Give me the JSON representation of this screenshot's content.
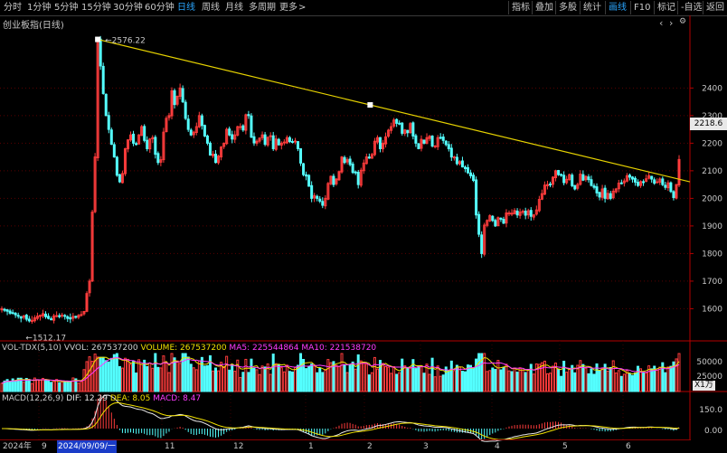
{
  "toolbar": {
    "periods": [
      "分时",
      "1分钟",
      "5分钟",
      "15分钟",
      "30分钟",
      "60分钟",
      "日线",
      "周线",
      "月线",
      "多周期",
      "更多"
    ],
    "active_period": "日线",
    "more_arrow": ">",
    "tools": [
      "指标",
      "叠加",
      "多股",
      "统计",
      "画线",
      "F10",
      "标记",
      "-自选",
      "返回"
    ],
    "active_tool": "画线"
  },
  "chart_title": "创业板指(日线)",
  "price_tag": "2218.6",
  "trendline_labels": {
    "high": "2576.22",
    "low": "1512.17"
  },
  "vol_panel": {
    "name": "VOL-TDX(5,10)",
    "items": [
      {
        "label": "VVOL: 267537200",
        "color": "#d0d0d0"
      },
      {
        "label": "VOLUME: 267537200",
        "color": "#f0e000"
      },
      {
        "label": "MA5: 225544864",
        "color": "#ff3bff"
      },
      {
        "label": "MA10: 221538720",
        "color": "#ff3bff"
      }
    ],
    "ticks": [
      "50000",
      "25000"
    ],
    "unit": "X1万"
  },
  "macd_panel": {
    "name": "MACD(12,26,9)",
    "items": [
      {
        "label": "DIF: 12.29",
        "color": "#e8e8e8"
      },
      {
        "label": "DEA: 8.05",
        "color": "#f0e000"
      },
      {
        "label": "MACD: 8.47",
        "color": "#ff3bff"
      }
    ],
    "ticks": [
      "150.0",
      "0.00"
    ]
  },
  "date_axis": {
    "year": "2024年",
    "month_labels": [
      "9",
      "11",
      "12",
      "1",
      "2",
      "3",
      "4",
      "5",
      "6"
    ],
    "cursor_date": "2024/09/09/一"
  },
  "chart_data": {
    "type": "candlestick",
    "title": "创业板指(日线)",
    "ylim": [
      1490,
      2660
    ],
    "y_ticks": [
      1600,
      1700,
      1800,
      1900,
      2000,
      2100,
      2200,
      2300,
      2400
    ],
    "up_color": "#ff3c3c",
    "down_color": "#54ffff",
    "trendline": {
      "from_value": 2576.22,
      "to_value_at_right_edge": 2060
    },
    "close_path": [
      1600,
      1596,
      1591,
      1584,
      1583,
      1578,
      1573,
      1566,
      1574,
      1562,
      1556,
      1558,
      1567,
      1573,
      1576,
      1582,
      1571,
      1565,
      1561,
      1574,
      1575,
      1573,
      1577,
      1573,
      1565,
      1563,
      1572,
      1570,
      1576,
      1579,
      1590,
      1655,
      1700,
      1950,
      2150,
      2576,
      2480,
      2380,
      2300,
      2250,
      2196,
      2150,
      2084,
      2060,
      2090,
      2180,
      2212,
      2230,
      2200,
      2195,
      2230,
      2260,
      2210,
      2180,
      2215,
      2220,
      2160,
      2130,
      2140,
      2240,
      2290,
      2300,
      2390,
      2340,
      2370,
      2400,
      2350,
      2290,
      2250,
      2230,
      2240,
      2260,
      2300,
      2264,
      2226,
      2200,
      2157,
      2160,
      2130,
      2153,
      2186,
      2200,
      2250,
      2230,
      2215,
      2230,
      2260,
      2260,
      2248,
      2303,
      2300,
      2222,
      2201,
      2207,
      2218,
      2230,
      2196,
      2221,
      2227,
      2180,
      2215,
      2194,
      2200,
      2204,
      2220,
      2206,
      2204,
      2208,
      2180,
      2128,
      2086,
      2081,
      2044,
      2000,
      2010,
      2000,
      1990,
      1975,
      2000,
      2054,
      2080,
      2050,
      2070,
      2097,
      2150,
      2130,
      2140,
      2123,
      2094,
      2095,
      2050,
      2102,
      2128,
      2150,
      2146,
      2159,
      2207,
      2220,
      2180,
      2200,
      2223,
      2247,
      2260,
      2284,
      2272,
      2272,
      2236,
      2248,
      2238,
      2271,
      2226,
      2200,
      2180,
      2214,
      2200,
      2220,
      2225,
      2190,
      2190,
      2220,
      2220,
      2210,
      2195,
      2180,
      2150,
      2150,
      2126,
      2133,
      2114,
      2108,
      2093,
      2082,
      2065,
      1940,
      1870,
      1800,
      1903,
      1920,
      1937,
      1920,
      1900,
      1930,
      1925,
      1910,
      1947,
      1947,
      1946,
      1956,
      1940,
      1950,
      1953,
      1939,
      1955,
      1935,
      1940,
      1958,
      1996,
      2017,
      2048,
      2050,
      2050,
      2077,
      2100,
      2086,
      2084,
      2057,
      2069,
      2086,
      2046,
      2034,
      2050,
      2088,
      2066,
      2080,
      2068,
      2047,
      2040,
      2020,
      2005,
      2034,
      2000,
      2018,
      2000,
      2026,
      2034,
      2055,
      2054,
      2063,
      2082,
      2077,
      2070,
      2059,
      2047,
      2061,
      2060,
      2071,
      2082,
      2070,
      2055,
      2060,
      2070,
      2050,
      2040,
      2056,
      2025,
      2003,
      2050,
      2141
    ],
    "volume_series": [
      {
        "name": "VOLUME",
        "color": "#f0e000"
      },
      {
        "name": "MA5",
        "color": "#ff3bff"
      },
      {
        "name": "MA10",
        "color": "#ff3bff"
      }
    ],
    "macd_series": [
      {
        "name": "DIF",
        "color": "#e8e8e8"
      },
      {
        "name": "DEA",
        "color": "#f0e000"
      },
      {
        "name": "MACD",
        "color": "#ff3bff"
      }
    ]
  }
}
